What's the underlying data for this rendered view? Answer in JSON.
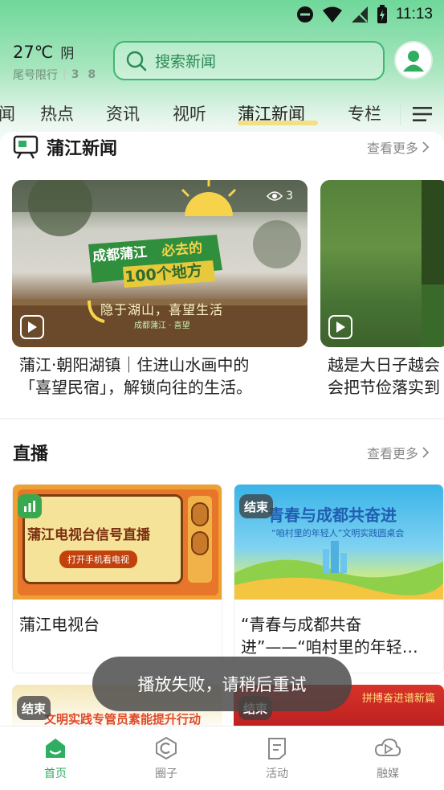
{
  "status_bar": {
    "time": "11:13"
  },
  "weather": {
    "temp": "27℃",
    "condition": "阴",
    "restriction_label": "尾号限行",
    "restriction_numbers": "3 8"
  },
  "search": {
    "placeholder": "搜索新闻"
  },
  "tabs": [
    {
      "label": "闻"
    },
    {
      "label": "热点"
    },
    {
      "label": "资讯"
    },
    {
      "label": "视听"
    },
    {
      "label": "蒲江新闻",
      "active": true
    },
    {
      "label": "专栏"
    }
  ],
  "news_section": {
    "title": "蒲江新闻",
    "more": "查看更多",
    "videos": [
      {
        "views": "3",
        "title_line1": "蒲江·朝阳湖镇｜住进山水画中的",
        "title_line2": "「喜望民宿」，解锁向往的生活。",
        "thumb_text": {
          "brand": "成都蒲江",
          "tag": "必去的",
          "count": "100个地方",
          "slogan": "隐于湖山，喜望生活",
          "credit": "成都蒲江 · 喜望"
        }
      },
      {
        "title_line1": "越是大日子越会",
        "title_line2": "会把节俭落实到"
      }
    ]
  },
  "live_section": {
    "title": "直播",
    "more": "查看更多",
    "items": [
      {
        "title": "蒲江电视台",
        "thumb_title": "蒲江电视台信号直播",
        "thumb_button": "打开手机看电视"
      },
      {
        "badge": "结束",
        "title": "“青春与成都共奋进”——“咱村里的年轻…",
        "thumb_title": "青春与成都共奋进",
        "thumb_sub": "“咱村里的年轻人”文明实践圆桌会"
      }
    ],
    "partial": [
      {
        "badge": "结束",
        "thumb_text": "文明实践专管员素能提升行动"
      },
      {
        "badge": "结束",
        "thumb_text": "拼搏奋进谱新篇"
      }
    ]
  },
  "toast": "播放失败，请稍后重试",
  "bottom_nav": [
    {
      "label": "首页",
      "active": true
    },
    {
      "label": "圈子"
    },
    {
      "label": "活动"
    },
    {
      "label": "融媒"
    }
  ],
  "colors": {
    "accent": "#2fae62",
    "header_green": "#6fd79a"
  }
}
